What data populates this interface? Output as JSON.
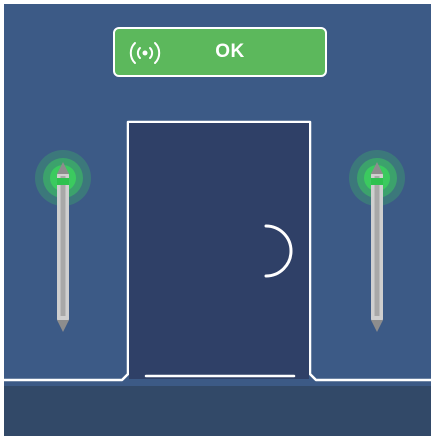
{
  "status": {
    "text": "OK",
    "state": "connected",
    "color": "#5cb85c",
    "icon": "wireless-signal-icon"
  },
  "colors": {
    "background": "#3c5a86",
    "door": "#2f4067",
    "floor": "#324968",
    "sensor_glow": "#3bd45c",
    "sensor_body": "#cfcfcf"
  },
  "sensors": [
    {
      "id": "left",
      "icon": "sensor-left-icon",
      "state": "active"
    },
    {
      "id": "right",
      "icon": "sensor-right-icon",
      "state": "active"
    }
  ],
  "door": {
    "icon": "door-icon",
    "handle_icon": "door-handle-icon"
  }
}
